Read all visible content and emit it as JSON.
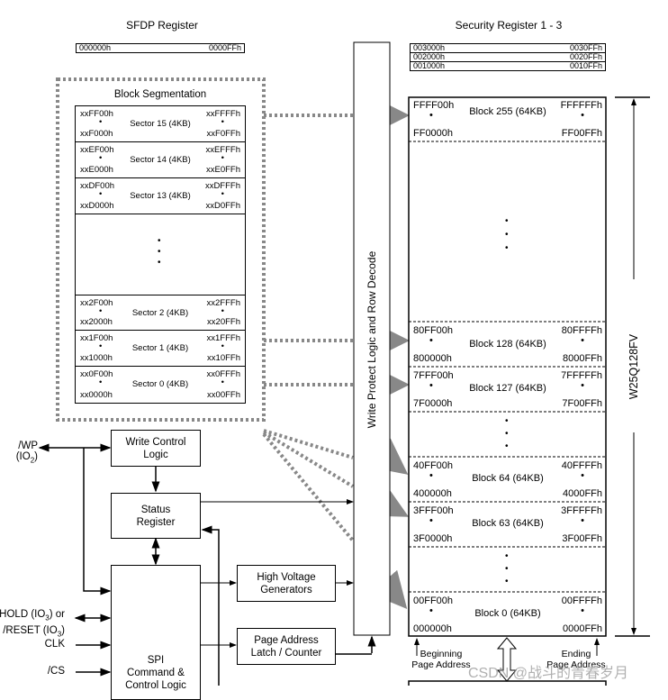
{
  "sfdp": {
    "title": "SFDP Register",
    "start": "000000h",
    "end": "0000FFh"
  },
  "security": {
    "title": "Security Register 1 - 3",
    "rows": [
      {
        "start": "003000h",
        "end": "0030FFh"
      },
      {
        "start": "002000h",
        "end": "0020FFh"
      },
      {
        "start": "001000h",
        "end": "0010FFh"
      }
    ]
  },
  "block_segmentation": {
    "title": "Block Segmentation",
    "sectors": [
      {
        "label": "Sector 15 (4KB)",
        "top_left": "xxFF00h",
        "bottom_left": "xxF000h",
        "top_right": "xxFFFFh",
        "bottom_right": "xxF0FFh"
      },
      {
        "label": "Sector 14 (4KB)",
        "top_left": "xxEF00h",
        "bottom_left": "xxE000h",
        "top_right": "xxEFFFh",
        "bottom_right": "xxE0FFh"
      },
      {
        "label": "Sector 13 (4KB)",
        "top_left": "xxDF00h",
        "bottom_left": "xxD000h",
        "top_right": "xxDFFFh",
        "bottom_right": "xxD0FFh"
      },
      {
        "label": "Sector 2 (4KB)",
        "top_left": "xx2F00h",
        "bottom_left": "xx2000h",
        "top_right": "xx2FFFh",
        "bottom_right": "xx20FFh"
      },
      {
        "label": "Sector 1 (4KB)",
        "top_left": "xx1F00h",
        "bottom_left": "xx1000h",
        "top_right": "xx1FFFh",
        "bottom_right": "xx10FFh"
      },
      {
        "label": "Sector 0 (4KB)",
        "top_left": "xx0F00h",
        "bottom_left": "xx0000h",
        "top_right": "xx0FFFh",
        "bottom_right": "xx00FFh"
      }
    ],
    "bullet": "•"
  },
  "memory_array": {
    "blocks": [
      {
        "label": "Block 255 (64KB)",
        "top_left": "FFFF00h",
        "bottom_left": "FF0000h",
        "top_right": "FFFFFFh",
        "bottom_right": "FF00FFh"
      },
      {
        "label": "Block 128 (64KB)",
        "top_left": "80FF00h",
        "bottom_left": "800000h",
        "top_right": "80FFFFh",
        "bottom_right": "8000FFh"
      },
      {
        "label": "Block 127 (64KB)",
        "top_left": "7FFF00h",
        "bottom_left": "7F0000h",
        "top_right": "7FFFFFh",
        "bottom_right": "7F00FFh"
      },
      {
        "label": "Block 64 (64KB)",
        "top_left": "40FF00h",
        "bottom_left": "400000h",
        "top_right": "40FFFFh",
        "bottom_right": "4000FFh"
      },
      {
        "label": "Block 63 (64KB)",
        "top_left": "3FFF00h",
        "bottom_left": "3F0000h",
        "top_right": "3FFFFFh",
        "bottom_right": "3F00FFh"
      },
      {
        "label": "Block 0 (64KB)",
        "top_left": "00FF00h",
        "bottom_left": "000000h",
        "top_right": "00FFFFh",
        "bottom_right": "0000FFh"
      }
    ],
    "chip_label": "W25Q128FV",
    "beginning_label_1": "Beginning",
    "beginning_label_2": "Page Address",
    "ending_label_1": "Ending",
    "ending_label_2": "Page Address"
  },
  "logic": {
    "write_protect": "Write Protect Logic and Row Decode",
    "write_control_1": "Write Control",
    "write_control_2": "Logic",
    "status_1": "Status",
    "status_2": "Register",
    "hv_1": "High Voltage",
    "hv_2": "Generators",
    "pal_1": "Page Address",
    "pal_2": "Latch / Counter",
    "spi_1": "SPI",
    "spi_2": "Command &",
    "spi_3": "Control Logic"
  },
  "pins": {
    "wp": "/WP (IO",
    "wp_sub": "2",
    "hold": "/HOLD (IO",
    "hold_sub": "3",
    "hold_suffix": ") or",
    "reset": "/RESET (IO",
    "reset_sub": "3",
    "clk": "CLK",
    "cs": "/CS"
  },
  "watermark": "CSDN @战斗的青春岁月"
}
